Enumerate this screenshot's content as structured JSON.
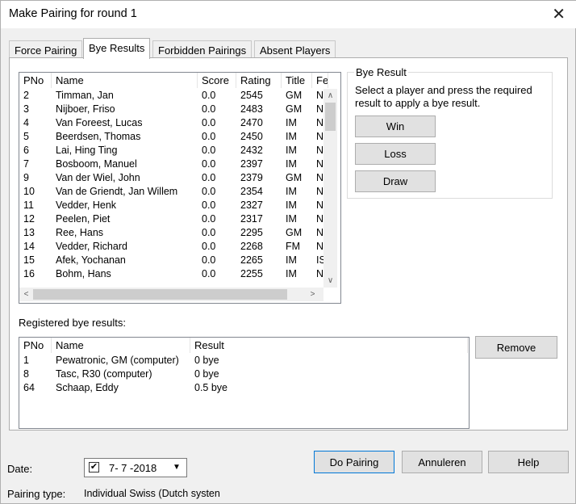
{
  "window": {
    "title": "Make Pairing for round 1",
    "close_glyph": "✕"
  },
  "tabs": [
    {
      "label": "Force Pairing"
    },
    {
      "label": "Bye Results"
    },
    {
      "label": "Forbidden Pairings"
    },
    {
      "label": "Absent Players"
    }
  ],
  "players_list": {
    "columns": [
      "PNo",
      "Name",
      "Score",
      "Rating",
      "Title",
      "Fe"
    ],
    "rows": [
      [
        "2",
        "Timman, Jan",
        "0.0",
        "2545",
        "GM",
        "N"
      ],
      [
        "3",
        "Nijboer, Friso",
        "0.0",
        "2483",
        "GM",
        "N"
      ],
      [
        "4",
        "Van Foreest, Lucas",
        "0.0",
        "2470",
        "IM",
        "N"
      ],
      [
        "5",
        "Beerdsen, Thomas",
        "0.0",
        "2450",
        "IM",
        "N"
      ],
      [
        "6",
        "Lai, Hing Ting",
        "0.0",
        "2432",
        "IM",
        "N"
      ],
      [
        "7",
        "Bosboom, Manuel",
        "0.0",
        "2397",
        "IM",
        "N"
      ],
      [
        "9",
        "Van der Wiel, John",
        "0.0",
        "2379",
        "GM",
        "N"
      ],
      [
        "10",
        "Van de Griendt, Jan Willem",
        "0.0",
        "2354",
        "IM",
        "N"
      ],
      [
        "11",
        "Vedder, Henk",
        "0.0",
        "2327",
        "IM",
        "N"
      ],
      [
        "12",
        "Peelen, Piet",
        "0.0",
        "2317",
        "IM",
        "N"
      ],
      [
        "13",
        "Ree, Hans",
        "0.0",
        "2295",
        "GM",
        "N"
      ],
      [
        "14",
        "Vedder, Richard",
        "0.0",
        "2268",
        "FM",
        "N"
      ],
      [
        "15",
        "Afek, Yochanan",
        "0.0",
        "2265",
        "IM",
        "IS"
      ],
      [
        "16",
        "Bohm, Hans",
        "0.0",
        "2255",
        "IM",
        "N"
      ]
    ]
  },
  "bye_result": {
    "legend": "Bye Result",
    "instruction": "Select a player and press the required result to apply a bye result.",
    "win_label": "Win",
    "loss_label": "Loss",
    "draw_label": "Draw"
  },
  "registered": {
    "label": "Registered bye results:",
    "columns": [
      "PNo",
      "Name",
      "Result"
    ],
    "rows": [
      [
        "1",
        "Pewatronic, GM (computer)",
        "0 bye"
      ],
      [
        "8",
        "Tasc, R30 (computer)",
        "0 bye"
      ],
      [
        "64",
        "Schaap, Eddy",
        "0.5 bye"
      ]
    ],
    "remove_label": "Remove"
  },
  "footer": {
    "date_label": "Date:",
    "date_value": "7- 7 -2018",
    "date_checked": "✔",
    "pairing_type_label": "Pairing type:",
    "pairing_type_value": "Individual Swiss (Dutch systen",
    "do_pairing_label": "Do Pairing",
    "cancel_label": "Annuleren",
    "help_label": "Help"
  },
  "icons": {
    "scroll_up": "∧",
    "scroll_down": "∨",
    "scroll_left": "<",
    "scroll_right": ">",
    "dropdown": "▼"
  }
}
